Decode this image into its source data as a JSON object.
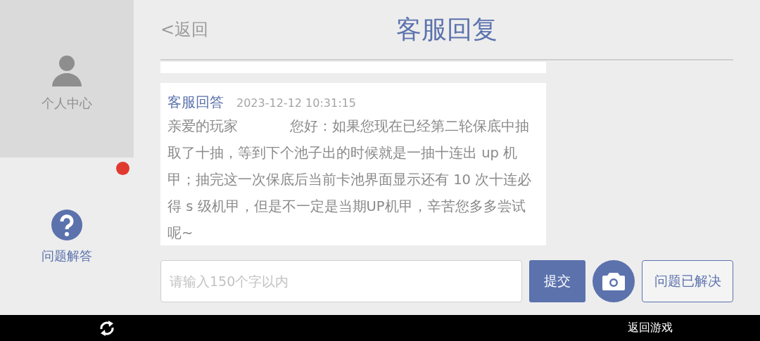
{
  "sidebar": {
    "items": [
      {
        "kind": "person",
        "label": "个人中心",
        "selected": true,
        "badge": false
      },
      {
        "kind": "help",
        "label": "问题解答",
        "selected": false,
        "badge": true
      }
    ]
  },
  "header": {
    "back": "<返回",
    "title": "客服回复"
  },
  "messages": [
    {
      "kind": "stub"
    },
    {
      "kind": "reply",
      "author": "客服回答",
      "time": "2023-12-12 10:31:15",
      "body": "亲爱的玩家            您好：如果您现在已经第二轮保底中抽取了十抽，等到下个池子出的时候就是一抽十连出 up 机甲；抽完这一次保底后当前卡池界面显示还有 10 次十连必得 s 级机甲，但是不一定是当期UP机甲，辛苦您多多尝试呢~"
    }
  ],
  "composer": {
    "placeholder": "请输入150个字以内",
    "submit": "提交",
    "resolved": "问题已解决"
  },
  "bottom_bar": {
    "back_to_game": "返回游戏"
  }
}
